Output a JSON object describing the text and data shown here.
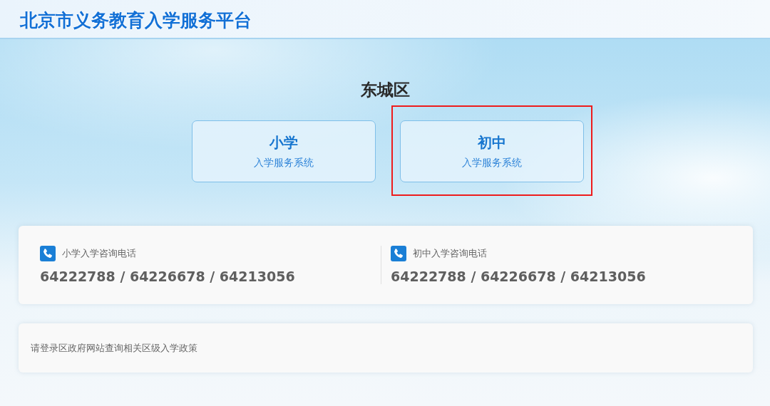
{
  "header": {
    "title": "北京市义务教育入学服务平台"
  },
  "district": "东城区",
  "systems": [
    {
      "title": "小学",
      "subtitle": "入学服务系统",
      "highlighted": false
    },
    {
      "title": "初中",
      "subtitle": "入学服务系统",
      "highlighted": true
    }
  ],
  "hotlines": [
    {
      "label": "小学入学咨询电话",
      "numbers": "64222788 / 64226678 / 64213056"
    },
    {
      "label": "初中入学咨询电话",
      "numbers": "64222788 / 64226678 / 64213056"
    }
  ],
  "notice": "请登录区政府网站查询相关区级入学政策"
}
